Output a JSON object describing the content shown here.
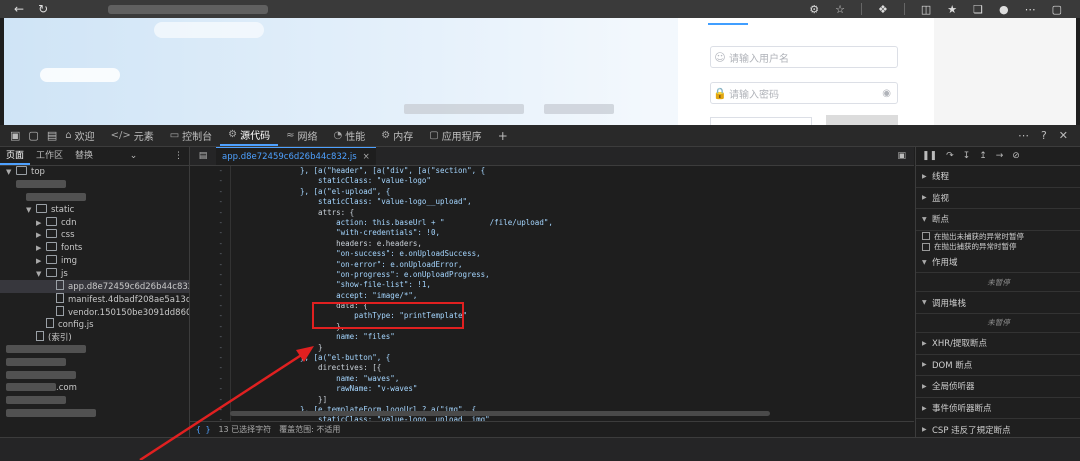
{
  "browser": {
    "icons": [
      "back-icon",
      "refresh-icon",
      "favorite-icon",
      "extensions-icon",
      "split-icon",
      "favorites-list-icon",
      "collections-icon",
      "profile-icon",
      "more-icon"
    ]
  },
  "login": {
    "username_placeholder": "请输入用户名",
    "password_placeholder": "请输入密码"
  },
  "devtools_tabs": [
    {
      "label": "欢迎",
      "icon": "home-icon"
    },
    {
      "label": "元素",
      "icon": "elements-icon"
    },
    {
      "label": "控制台",
      "icon": "console-icon"
    },
    {
      "label": "源代码",
      "icon": "sources-icon",
      "active": true
    },
    {
      "label": "网络",
      "icon": "wifi-icon"
    },
    {
      "label": "性能",
      "icon": "performance-icon"
    },
    {
      "label": "内存",
      "icon": "memory-icon"
    },
    {
      "label": "应用程序",
      "icon": "application-icon"
    }
  ],
  "navigator": {
    "subtabs": [
      "页面",
      "工作区",
      "替换"
    ],
    "tree": [
      {
        "label": "top",
        "type": "folder",
        "indent": 0,
        "expanded": true
      },
      {
        "label": "",
        "type": "blur",
        "indent": 1
      },
      {
        "label": "",
        "type": "blur",
        "indent": 2
      },
      {
        "label": "static",
        "type": "folder",
        "indent": 2,
        "expanded": true
      },
      {
        "label": "cdn",
        "type": "folder",
        "indent": 3
      },
      {
        "label": "css",
        "type": "folder",
        "indent": 3
      },
      {
        "label": "fonts",
        "type": "folder",
        "indent": 3
      },
      {
        "label": "img",
        "type": "folder",
        "indent": 3
      },
      {
        "label": "js",
        "type": "folder",
        "indent": 3,
        "expanded": true
      },
      {
        "label": "app.d8e72459c6d26b44c832.js",
        "type": "file",
        "indent": 4,
        "selected": true
      },
      {
        "label": "manifest.4dbadf208ae5a13c0e51.js",
        "type": "file",
        "indent": 4
      },
      {
        "label": "vendor.150150be3091dd8605ed.js",
        "type": "file",
        "indent": 4
      },
      {
        "label": "config.js",
        "type": "file",
        "indent": 3
      },
      {
        "label": "(索引)",
        "type": "file",
        "indent": 2
      },
      {
        "label": "",
        "type": "blur",
        "indent": 0
      },
      {
        "label": "",
        "type": "blur",
        "indent": 0
      },
      {
        "label": "",
        "type": "blur",
        "indent": 0
      },
      {
        "label": ".com",
        "type": "blurtext",
        "indent": 0
      },
      {
        "label": "",
        "type": "blur",
        "indent": 0
      },
      {
        "label": "",
        "type": "blur",
        "indent": 0
      }
    ]
  },
  "editor": {
    "tab_label": "app.d8e72459c6d26b44c832.js",
    "status_selected": "13 已选择字符",
    "status_coverage": "覆盖范围: 不适用",
    "status_braces": "{ }",
    "line_numbers": [
      "-",
      "-",
      "-",
      "-",
      "-",
      "-",
      "-",
      "-",
      "-",
      "-",
      "-",
      "-",
      "-",
      "-",
      "-",
      "-",
      "-",
      "-",
      "-",
      "-",
      "-",
      "-",
      "-",
      "-",
      "-"
    ],
    "code": [
      "}, [a(\"header\", [a(\"div\", [a(\"section\", {",
      "    staticClass: \"value-logo\"",
      "}, [a(\"el-upload\", {",
      "    staticClass: \"value-logo__upload\",",
      "    attrs: {",
      "        action: this.baseUrl + \"          /file/upload\",",
      "        \"with-credentials\": !0,",
      "        headers: e.headers,",
      "        \"on-success\": e.onUploadSuccess,",
      "        \"on-error\": e.onUploadError,",
      "        \"on-progress\": e.onUploadProgress,",
      "        \"show-file-list\": !1,",
      "        accept: \"image/*\",",
      "        data: {",
      "            pathType: \"printTemplate\"",
      "        },",
      "        name: \"files\"",
      "    }",
      "}, [a(\"el-button\", {",
      "    directives: [{",
      "        name: \"waves\",",
      "        rawName: \"v-waves\"",
      "    }]",
      "}, [e.templateForm.logoUrl ? a(\"img\", {",
      "    staticClass: \"value-logo__upload__img\""
    ]
  },
  "debugger": {
    "sections": [
      {
        "label": "线程",
        "kind": "section"
      },
      {
        "label": "监视",
        "kind": "section"
      },
      {
        "label": "断点",
        "kind": "section",
        "expanded": true
      },
      {
        "label": "在抛出未捕获的异常时暂停",
        "kind": "checkbox"
      },
      {
        "label": "在抛出捕获的异常时暂停",
        "kind": "checkbox"
      },
      {
        "label": "作用域",
        "kind": "section",
        "expanded": true
      },
      {
        "label": "未暂停",
        "kind": "muted"
      },
      {
        "label": "调用堆栈",
        "kind": "section",
        "expanded": true
      },
      {
        "label": "未暂停",
        "kind": "muted"
      },
      {
        "label": "XHR/提取断点",
        "kind": "section"
      },
      {
        "label": "DOM 断点",
        "kind": "section"
      },
      {
        "label": "全局侦听器",
        "kind": "section"
      },
      {
        "label": "事件侦听器断点",
        "kind": "section"
      },
      {
        "label": "CSP 违反了規定断点",
        "kind": "section"
      }
    ]
  },
  "colors": {
    "accent": "#4ea1ff",
    "highlight_box": "#e02020",
    "annotation_arrow": "#e02020"
  }
}
